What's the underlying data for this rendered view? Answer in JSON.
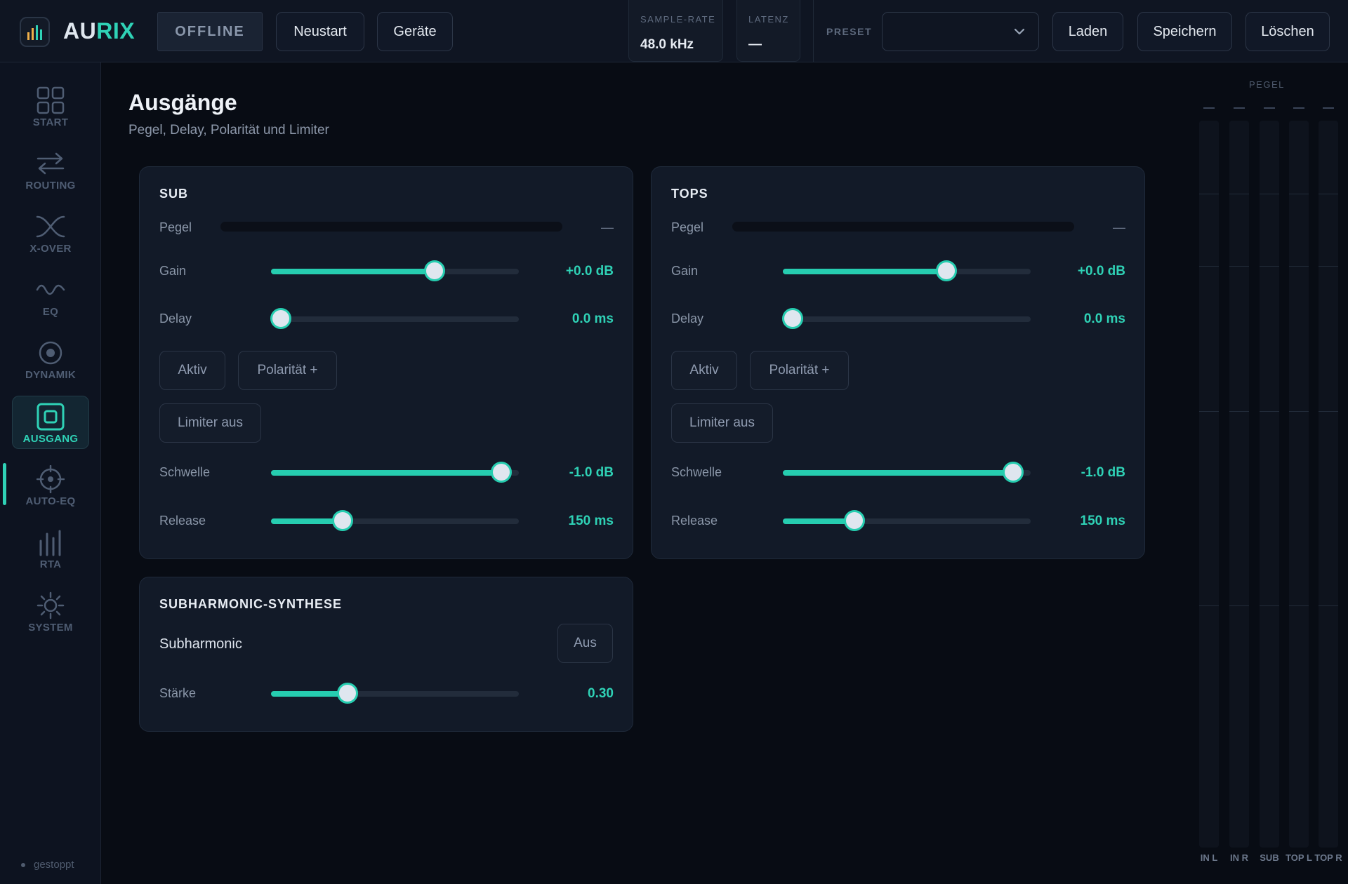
{
  "app": {
    "brand_part1": "AU",
    "brand_part2": "RIX",
    "status": "OFFLINE"
  },
  "toolbar": {
    "restart_label": "Neustart",
    "devices_label": "Geräte",
    "sample_rate_label": "SAMPLE-RATE",
    "sample_rate_value": "48.0 kHz",
    "latency_label": "LATENZ",
    "latency_value": "—",
    "preset_label": "PRESET",
    "preset_value": "",
    "load_label": "Laden",
    "save_label": "Speichern",
    "delete_label": "Löschen"
  },
  "sidebar": {
    "items": [
      {
        "label": "START",
        "icon": "grid-icon",
        "active": false
      },
      {
        "label": "ROUTING",
        "icon": "arrows-swap-icon",
        "active": false
      },
      {
        "label": "X-OVER",
        "icon": "crossover-icon",
        "active": false
      },
      {
        "label": "EQ",
        "icon": "wave-icon",
        "active": false
      },
      {
        "label": "DYNAMIK",
        "icon": "target-icon",
        "active": false
      },
      {
        "label": "AUSGANG",
        "icon": "output-square-icon",
        "active": true
      },
      {
        "label": "AUTO-EQ",
        "icon": "crosshair-icon",
        "active": false
      },
      {
        "label": "RTA",
        "icon": "bars-icon",
        "active": false
      },
      {
        "label": "SYSTEM",
        "icon": "sun-gear-icon",
        "active": false
      }
    ],
    "status": "gestoppt"
  },
  "page": {
    "title": "Ausgänge",
    "subtitle": "Pegel, Delay, Polarität und Limiter"
  },
  "labels": {
    "level": "Pegel",
    "gain": "Gain",
    "delay": "Delay",
    "threshold": "Schwelle",
    "release": "Release"
  },
  "outputs": [
    {
      "title": "SUB",
      "level_value": "—",
      "gain": {
        "value": "+0.0 dB",
        "fraction": 0.66
      },
      "delay": {
        "value": "0.0 ms",
        "fraction": 0.04
      },
      "active_label": "Aktiv",
      "polarity_label": "Polarität +",
      "limiter_label": "Limiter aus",
      "threshold": {
        "value": "-1.0 dB",
        "fraction": 0.93
      },
      "release": {
        "value": "150 ms",
        "fraction": 0.29
      }
    },
    {
      "title": "TOPS",
      "level_value": "—",
      "gain": {
        "value": "+0.0 dB",
        "fraction": 0.66
      },
      "delay": {
        "value": "0.0 ms",
        "fraction": 0.04
      },
      "active_label": "Aktiv",
      "polarity_label": "Polarität +",
      "limiter_label": "Limiter aus",
      "threshold": {
        "value": "-1.0 dB",
        "fraction": 0.93
      },
      "release": {
        "value": "150 ms",
        "fraction": 0.29
      }
    }
  ],
  "subharmonic": {
    "title": "SUBHARMONIC-SYNTHESE",
    "label": "Subharmonic",
    "toggle_label": "Aus",
    "strength_label": "Stärke",
    "strength": {
      "value": "0.30",
      "fraction": 0.31
    }
  },
  "level_panel": {
    "title": "PEGEL",
    "channels": [
      "IN L",
      "IN R",
      "SUB",
      "TOP L",
      "TOP R"
    ]
  },
  "colors": {
    "accent": "#2fd2b6",
    "background": "#080c14",
    "panel": "#121a28"
  }
}
